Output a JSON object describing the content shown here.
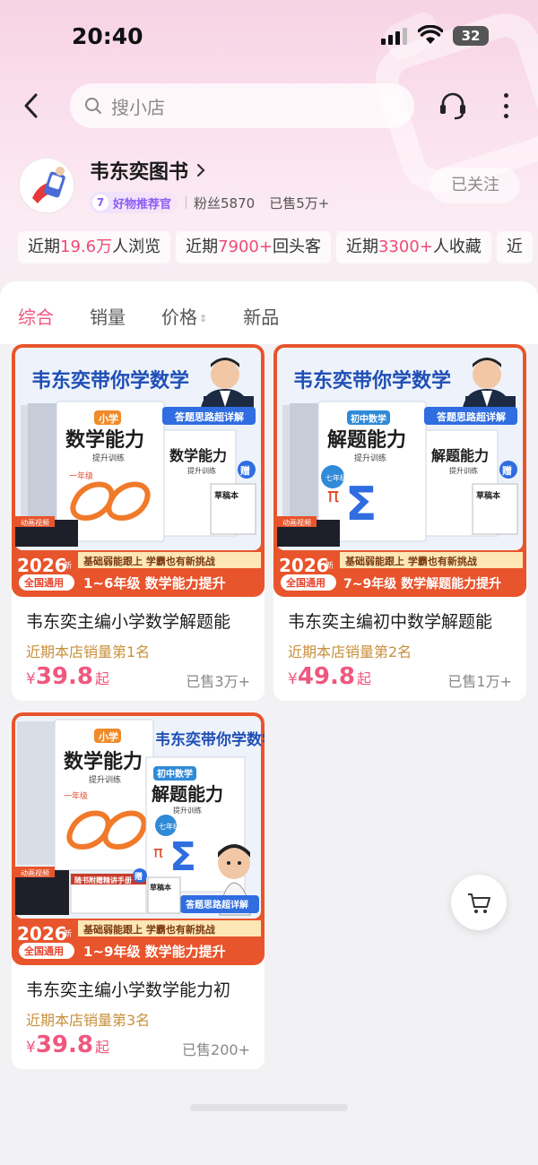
{
  "status": {
    "time": "20:40",
    "battery": "32"
  },
  "search": {
    "placeholder": "搜小店"
  },
  "shop": {
    "name": "韦东奕图书",
    "badge_level": "7",
    "badge_text": "好物推荐官",
    "followers": "粉丝5870",
    "sold": "已售5万+",
    "follow_label": "已关注"
  },
  "stats": [
    {
      "pre": "近期",
      "hl": "19.6万",
      "post": "人浏览"
    },
    {
      "pre": "近期",
      "hl": "7900+",
      "post": "回头客"
    },
    {
      "pre": "近期",
      "hl": "3300+",
      "post": "人收藏"
    },
    {
      "pre": "近",
      "hl": "",
      "post": ""
    }
  ],
  "tabs": [
    {
      "label": "综合",
      "active": true
    },
    {
      "label": "销量",
      "active": false
    },
    {
      "label": "价格",
      "active": false
    },
    {
      "label": "新品",
      "active": false
    }
  ],
  "products": [
    {
      "title": "韦东奕主编小学数学解题能",
      "rank": "近期本店销量第1名",
      "price_symbol": "¥",
      "price": "39.8",
      "price_suffix": "起",
      "sold": "已售3万+",
      "image": {
        "headline": "韦东奕带你学数学",
        "stage": "小学",
        "book_title": "数学能力",
        "sub": "提升训练",
        "grade": "一年级",
        "tag": "答题思路超详解",
        "gift": "草稿本",
        "gift_word": "赠",
        "video": "动画视频",
        "year": "2026",
        "year_suffix": "新",
        "scope": "全国通用",
        "slogan": "基础弱能跟上 学霸也有新挑战",
        "banner": "1~6年级 数学能力提升"
      }
    },
    {
      "title": "韦东奕主编初中数学解题能",
      "rank": "近期本店销量第2名",
      "price_symbol": "¥",
      "price": "49.8",
      "price_suffix": "起",
      "sold": "已售1万+",
      "image": {
        "headline": "韦东奕带你学数学",
        "stage": "初中数学",
        "book_title": "解题能力",
        "sub": "提升训练",
        "grade": "七年级",
        "tag": "答题思路超详解",
        "gift": "草稿本",
        "gift_word": "赠",
        "video": "动画视频",
        "year": "2026",
        "year_suffix": "新",
        "scope": "全国通用",
        "slogan": "基础弱能跟上 学霸也有新挑战",
        "banner": "7~9年级 数学解题能力提升"
      }
    },
    {
      "title": "韦东奕主编小学数学能力初",
      "rank": "近期本店销量第3名",
      "price_symbol": "¥",
      "price": "39.8",
      "price_suffix": "起",
      "sold": "已售200+",
      "image": {
        "headline": "韦东奕带你学数学",
        "stage": "小学",
        "book_title": "数学能力",
        "sub": "提升训练",
        "grade": "一年级",
        "stage2": "初中数学",
        "book_title2": "解题能力",
        "grade2": "七年级",
        "tag": "答题思路超详解",
        "gift": "草稿本",
        "gift_word": "赠",
        "handbook": "随书附赠精讲手册",
        "video": "动画视频",
        "year": "2026",
        "year_suffix": "新",
        "scope": "全国通用",
        "slogan": "基础弱能跟上 学霸也有新挑战",
        "banner": "1~9年级 数学能力提升"
      }
    }
  ],
  "colors": {
    "accent": "#f0577f",
    "rank": "#c8903c",
    "banner_red": "#e8432c",
    "banner_orange": "#f39a2a"
  }
}
